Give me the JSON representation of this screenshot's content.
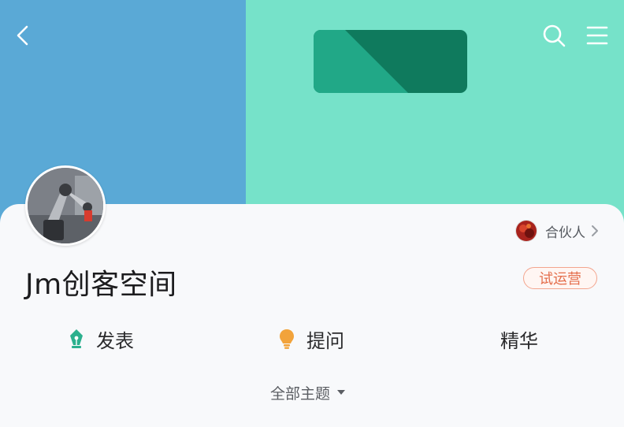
{
  "header": {
    "colors": {
      "left": "#5aa9d6",
      "right": "#76e2c9",
      "card": "#0f7a5d",
      "card_stripe": "#21a887"
    },
    "back_icon": "chevron-left-icon",
    "search_icon": "search-icon",
    "menu_icon": "menu-icon"
  },
  "profile": {
    "name": "Jm创客空间",
    "badge": "试运营",
    "partner_label": "合伙人",
    "accent_badge": "#e46e4c"
  },
  "actions": [
    {
      "label": "发表",
      "icon": "pen-nib-icon",
      "color": "#2bb08e"
    },
    {
      "label": "提问",
      "icon": "lightbulb-icon",
      "color": "#f2a33b"
    },
    {
      "label": "精华",
      "icon": "",
      "color": ""
    }
  ],
  "filter": {
    "label": "全部主题",
    "icon": "caret-down-icon"
  }
}
